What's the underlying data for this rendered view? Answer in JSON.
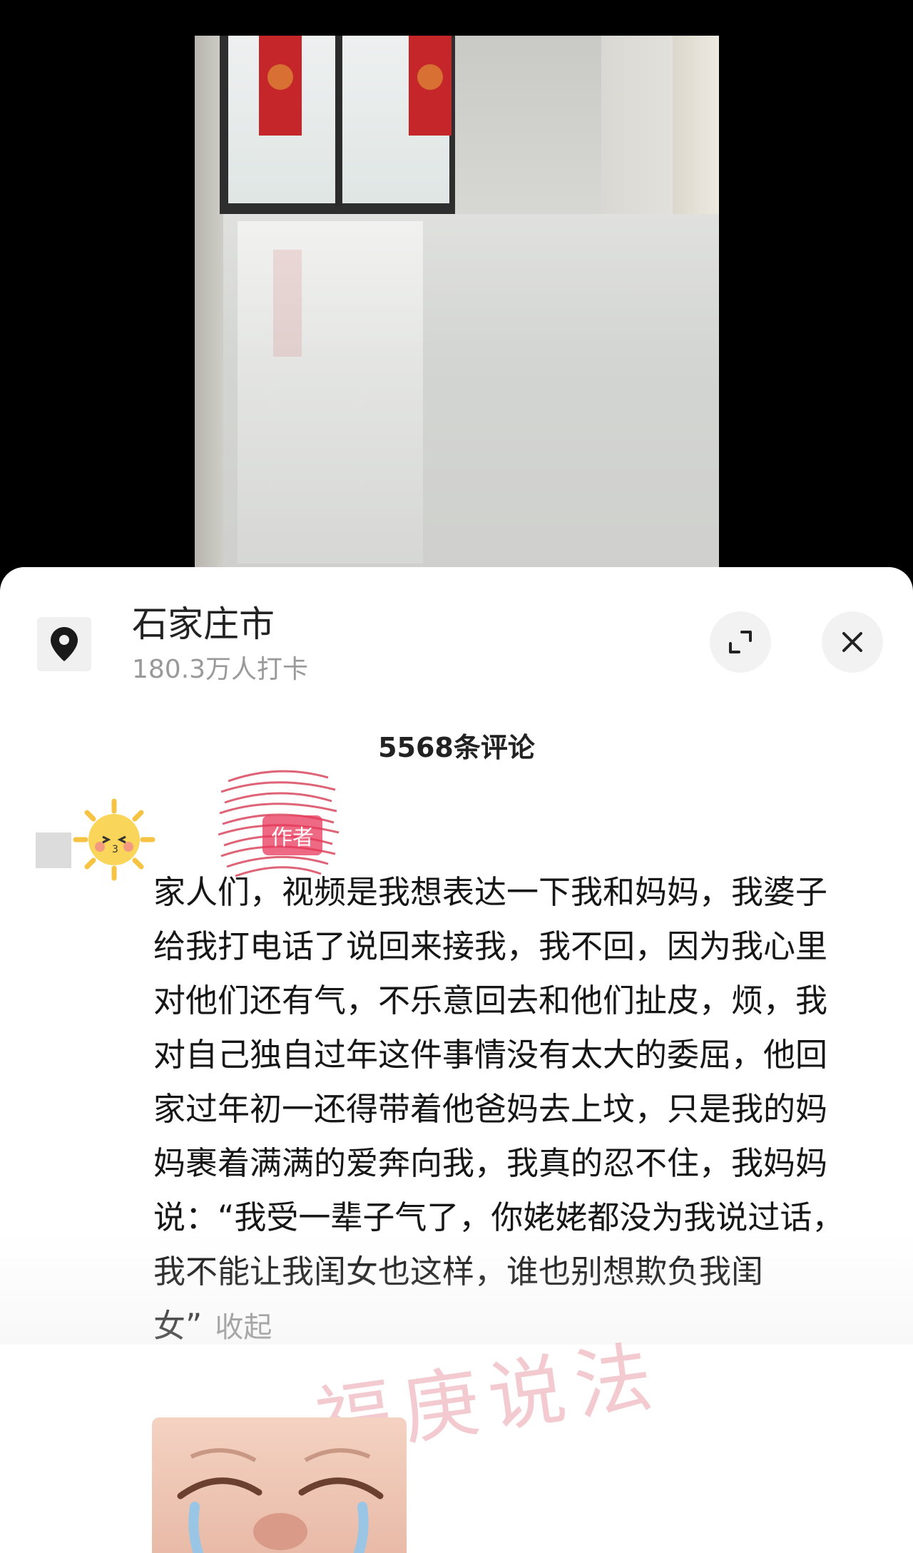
{
  "location": {
    "name": "石家庄市",
    "checkins": "180.3万人打卡"
  },
  "comments": {
    "count_label": "5568条评论"
  },
  "comment": {
    "author_badge": "作者",
    "text": "家人们，视频是我想表达一下我和妈妈，我婆子给我打电话了说回来接我，我不回，因为我心里对他们还有气，不乐意回去和他们扯皮，烦，我对自己独自过年这件事情没有太大的委屈，他回家过年初一还得带着他爸妈去上坟，只是我的妈妈裹着满满的爱奔向我，我真的忍不住，我妈妈说：“我受一辈子气了，你姥姥都没为我说过话，我不能让我闺女也这样，谁也别想欺负我闺女”",
    "collapse_label": "收起"
  },
  "watermark": "福庚说法",
  "icons": {
    "location": "location-pin-icon",
    "expand": "expand-icon",
    "close": "close-icon"
  },
  "colors": {
    "author_badge": "#e9375a",
    "couplet_red": "#c4262a"
  }
}
